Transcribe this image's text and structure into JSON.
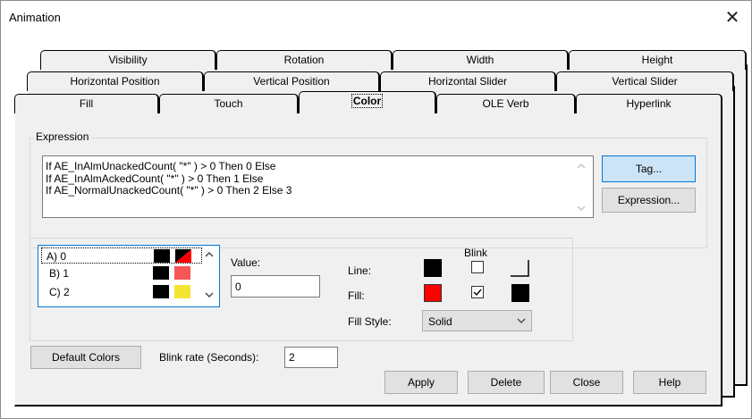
{
  "window": {
    "title": "Animation",
    "close_glyph": "✕"
  },
  "tabs": {
    "row1": [
      "Visibility",
      "Rotation",
      "Width",
      "Height"
    ],
    "row2": [
      "Horizontal Position",
      "Vertical Position",
      "Horizontal Slider",
      "Vertical Slider"
    ],
    "row3": [
      "Fill",
      "Touch",
      "Color",
      "OLE Verb",
      "Hyperlink"
    ],
    "active": "Color"
  },
  "expression": {
    "group_label": "Expression",
    "lines": [
      "If AE_InAlmUnackedCount( \"*\" ) > 0 Then 0 Else",
      "If AE_InAlmAckedCount( \"*\" ) > 0 Then 1 Else",
      "If AE_NormalUnackedCount( \"*\" ) > 0 Then 2 Else 3"
    ],
    "tag_button": "Tag...",
    "expression_button": "Expression..."
  },
  "states": {
    "items": [
      {
        "label": "A) 0",
        "line_color": "#000000",
        "fill_color": "#ff0000",
        "blink": true
      },
      {
        "label": "B) 1",
        "line_color": "#000000",
        "fill_color": "#f75656",
        "blink": false
      },
      {
        "label": "C) 2",
        "line_color": "#000000",
        "fill_color": "#f5e432",
        "blink": false
      }
    ],
    "selected_index": 0
  },
  "value": {
    "label": "Value:",
    "current": "0"
  },
  "appearance": {
    "blink_header": "Blink",
    "line_label": "Line:",
    "fill_label": "Fill:",
    "fill_style_label": "Fill Style:",
    "fill_style_value": "Solid",
    "line_color": "#000000",
    "fill_color": "#ff0000",
    "line_blink": false,
    "fill_blink": true,
    "fill_blink_color": "#000000"
  },
  "footer": {
    "default_colors": "Default Colors",
    "blink_rate_label": "Blink rate (Seconds):",
    "blink_rate_value": "2",
    "apply": "Apply",
    "delete": "Delete",
    "close": "Close",
    "help": "Help"
  }
}
